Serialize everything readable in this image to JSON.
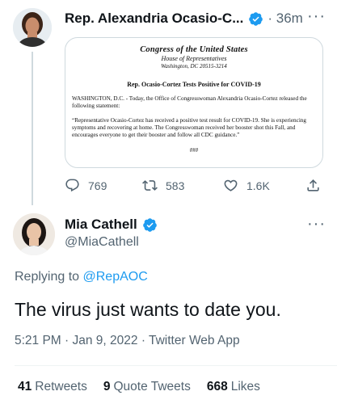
{
  "parent_tweet": {
    "author_name": "Rep. Alexandria Ocasio-C...",
    "time": "· 36m",
    "more": "···",
    "document": {
      "congress": "Congress of the United States",
      "house": "House of Representatives",
      "address": "Washington, DC 20515-3214",
      "title": "Rep. Ocasio-Cortez Tests Positive for COVID-19",
      "para1": "WASHINGTON, D.C. - Today, the Office of Congresswoman Alexandria Ocasio-Cortez released the following statement:",
      "para2": "“Representative Ocasio-Cortez has received a positive test result for COVID-19. She is experiencing symptoms and recovering at home. The Congresswoman received her booster shot this Fall, and encourages everyone to get their booster and follow all CDC guidance.”",
      "end": "###"
    },
    "replies": "769",
    "retweets": "583",
    "likes": "1.6K"
  },
  "main_tweet": {
    "author_name": "Mia Cathell",
    "handle": "@MiaCathell",
    "more": "···",
    "replying_prefix": "Replying to",
    "replying_to": "@RepAOC",
    "text": "The virus just wants to date you.",
    "meta": "5:21 PM · Jan 9, 2022 · Twitter Web App",
    "stats": {
      "retweets_count": "41",
      "retweets_label": "Retweets",
      "quotes_count": "9",
      "quotes_label": "Quote Tweets",
      "likes_count": "668",
      "likes_label": "Likes"
    }
  },
  "colors": {
    "accent": "#1d9bf0",
    "secondary_text": "#536471",
    "primary_text": "#0f1419",
    "thread_line": "#cfd9de"
  }
}
